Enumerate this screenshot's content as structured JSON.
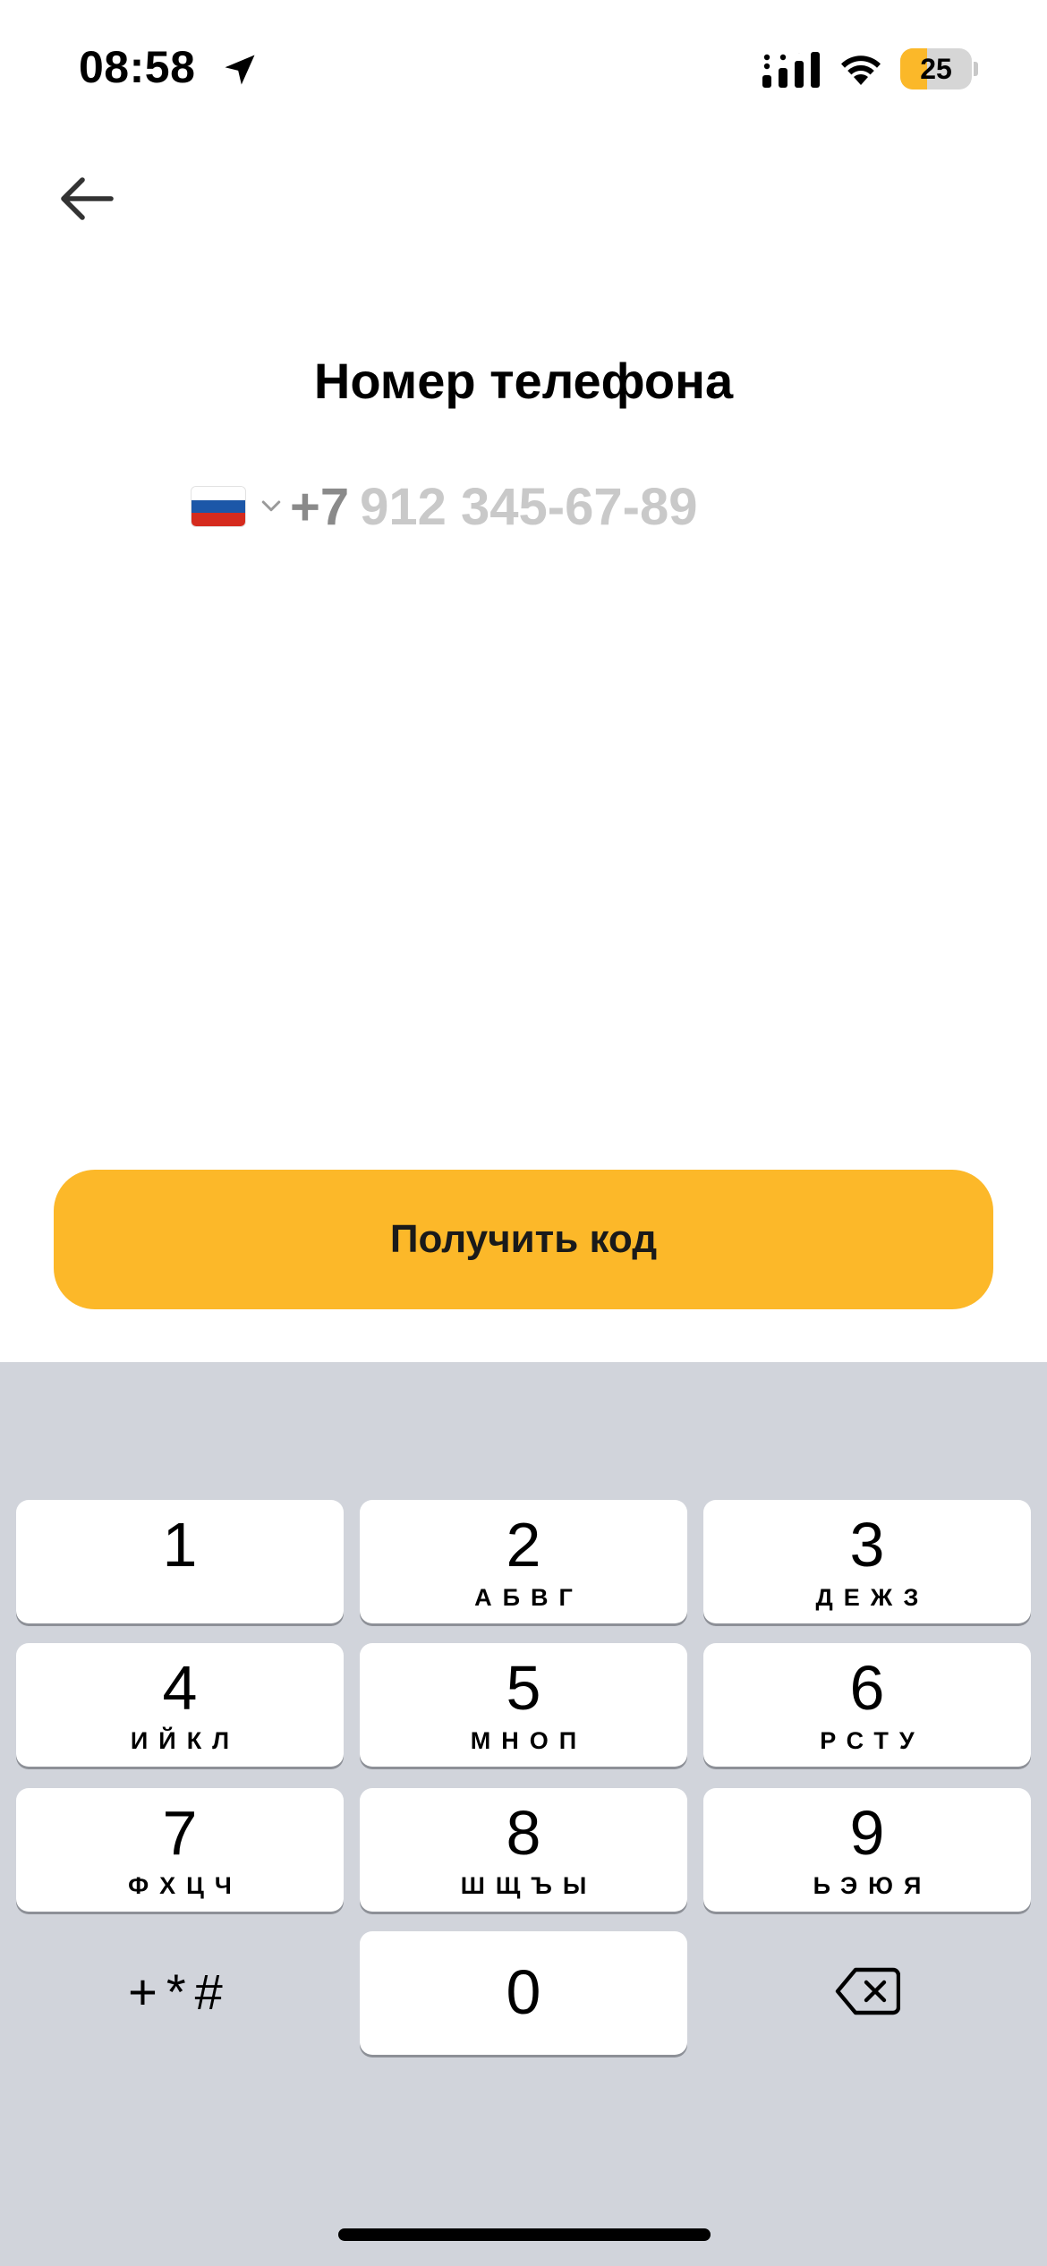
{
  "status_bar": {
    "time": "08:58",
    "battery": "25",
    "battery_level_percent": 25,
    "icons": [
      "location-arrow-icon",
      "cellular-signal-icon",
      "wifi-icon",
      "battery-icon"
    ]
  },
  "nav": {
    "back_icon": "arrow-left-icon"
  },
  "title": "Номер телефона",
  "phone": {
    "country_flag": "russia-flag-icon",
    "chevron_icon": "chevron-down-icon",
    "prefix": "+7",
    "placeholder": "912 345-67-89"
  },
  "button": {
    "label": "Получить код"
  },
  "keypad": {
    "keys": [
      {
        "digit": "1",
        "letters": ""
      },
      {
        "digit": "2",
        "letters": "АБВГ"
      },
      {
        "digit": "3",
        "letters": "ДЕЖЗ"
      },
      {
        "digit": "4",
        "letters": "ИЙКЛ"
      },
      {
        "digit": "5",
        "letters": "МНОП"
      },
      {
        "digit": "6",
        "letters": "РСТУ"
      },
      {
        "digit": "7",
        "letters": "ФХЦЧ"
      },
      {
        "digit": "8",
        "letters": "ШЩЪЫ"
      },
      {
        "digit": "9",
        "letters": "ЬЭЮЯ"
      },
      {
        "digit": "0",
        "letters": ""
      }
    ],
    "symbols": "+*#",
    "delete_icon": "backspace-icon"
  },
  "colors": {
    "accent": "#FCB829",
    "keyboard_bg": "#D1D4DB",
    "placeholder": "#C9C9C9",
    "prefix": "#8A8A8A"
  }
}
